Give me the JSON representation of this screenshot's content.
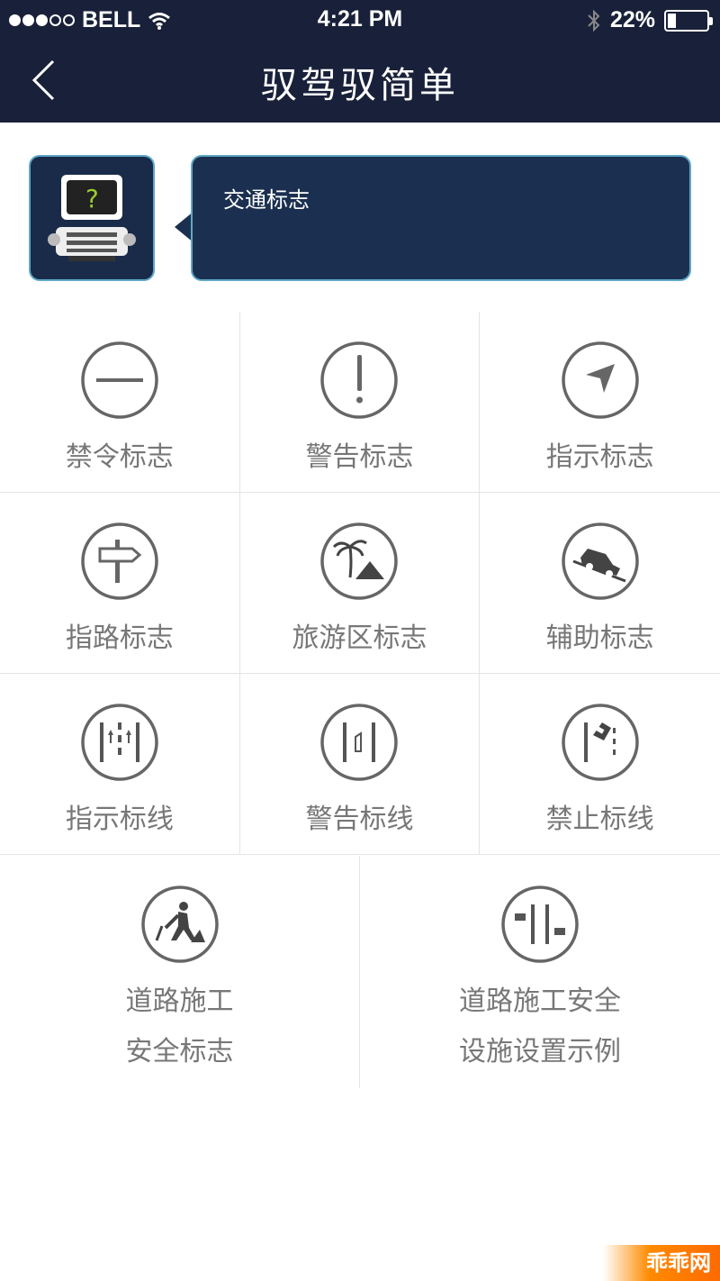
{
  "status_bar": {
    "carrier": "BELL",
    "time": "4:21 PM",
    "battery": "22%",
    "battery_level": 0.22
  },
  "nav": {
    "title": "驭驾驭简单"
  },
  "banner": {
    "message": "交通标志"
  },
  "categories": [
    {
      "label": "禁令标志",
      "icon": "prohibition-icon"
    },
    {
      "label": "警告标志",
      "icon": "warning-icon"
    },
    {
      "label": "指示标志",
      "icon": "direction-arrow-icon"
    },
    {
      "label": "指路标志",
      "icon": "signpost-icon"
    },
    {
      "label": "旅游区标志",
      "icon": "palm-tree-icon"
    },
    {
      "label": "辅助标志",
      "icon": "car-slope-icon"
    },
    {
      "label": "指示标线",
      "icon": "lane-arrows-icon"
    },
    {
      "label": "警告标线",
      "icon": "lane-warning-icon"
    },
    {
      "label": "禁止标线",
      "icon": "no-crossing-line-icon"
    }
  ],
  "construction": [
    {
      "line1": "道路施工",
      "line2": "安全标志",
      "icon": "road-worker-icon"
    },
    {
      "line1": "道路施工安全",
      "line2": "设施设置示例",
      "icon": "barrier-layout-icon"
    }
  ],
  "watermark": "乖乖网"
}
